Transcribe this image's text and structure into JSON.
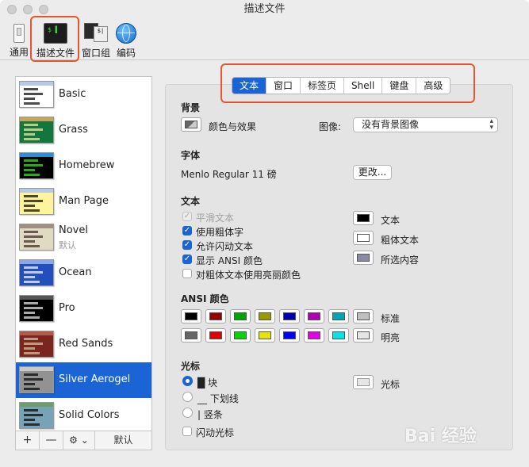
{
  "window": {
    "title": "描述文件"
  },
  "toolbar": {
    "items": [
      {
        "label": "通用",
        "icon": "switch-icon"
      },
      {
        "label": "描述文件",
        "icon": "terminal-icon"
      },
      {
        "label": "窗口组",
        "icon": "window-group-icon"
      },
      {
        "label": "编码",
        "icon": "globe-icon"
      }
    ]
  },
  "profiles": [
    {
      "name": "Basic",
      "color": "#ffffff",
      "fg": "#000000",
      "bar": "#b8c9e8"
    },
    {
      "name": "Grass",
      "color": "#13773d",
      "fg": "#fff0a5",
      "bar": "#c7a55a"
    },
    {
      "name": "Homebrew",
      "color": "#000000",
      "fg": "#28fe14",
      "bar": "#2a8fd6"
    },
    {
      "name": "Man Page",
      "color": "#fef49c",
      "fg": "#000000",
      "bar": "#b8c9e8"
    },
    {
      "name": "Novel",
      "sub": "默认",
      "color": "#dfdbc3",
      "fg": "#3b2322",
      "bar": "#9e8f7e"
    },
    {
      "name": "Ocean",
      "color": "#224fbc",
      "fg": "#ffffff",
      "bar": "#8aa8e8"
    },
    {
      "name": "Pro",
      "color": "#000000",
      "fg": "#f2f2f2",
      "bar": "#555555"
    },
    {
      "name": "Red Sands",
      "color": "#7a251e",
      "fg": "#d7c9a7",
      "bar": "#b35b4a"
    },
    {
      "name": "Silver Aerogel",
      "color": "#929292",
      "fg": "#000000",
      "bar": "#c9c9c9",
      "selected": true
    },
    {
      "name": "Solid Colors",
      "color": "#78a2b5",
      "fg": "#000000",
      "bar": "#6a9e6a"
    }
  ],
  "sidebar_bottom": {
    "add": "+",
    "remove": "—",
    "gear": "⚙ ⌄",
    "default": "默认"
  },
  "tabs": [
    {
      "label": "文本",
      "active": true
    },
    {
      "label": "窗口"
    },
    {
      "label": "标签页"
    },
    {
      "label": "Shell"
    },
    {
      "label": "键盘"
    },
    {
      "label": "高级"
    }
  ],
  "background": {
    "section": "背景",
    "color_effects": "颜色与效果",
    "image_label": "图像:",
    "image_value": "没有背景图像"
  },
  "font": {
    "section": "字体",
    "value": "Menlo Regular 11 磅",
    "change_button": "更改..."
  },
  "text": {
    "section": "文本",
    "options": [
      {
        "label": "平滑文本",
        "checked": true,
        "disabled": true
      },
      {
        "label": "使用粗体字",
        "checked": true
      },
      {
        "label": "允许闪动文本",
        "checked": true
      },
      {
        "label": "显示 ANSI 颜色",
        "checked": true
      },
      {
        "label": "对粗体文本使用亮丽颜色",
        "checked": false
      }
    ],
    "swatches": [
      {
        "label": "文本",
        "color": "#000000"
      },
      {
        "label": "粗体文本",
        "color": "#ffffff"
      },
      {
        "label": "所选内容",
        "color": "#8a8aa3"
      }
    ]
  },
  "ansi": {
    "section": "ANSI 颜色",
    "normal_label": "标准",
    "bright_label": "明亮",
    "normal": [
      "#000000",
      "#990000",
      "#00a600",
      "#999900",
      "#0000b2",
      "#b200b2",
      "#00a6b2",
      "#bfbfbf"
    ],
    "bright": [
      "#666666",
      "#e50000",
      "#00d900",
      "#e5e500",
      "#0000ff",
      "#e500e5",
      "#00e5e5",
      "#e5e5e5"
    ]
  },
  "cursor": {
    "section": "光标",
    "options": [
      {
        "label": "█ 块",
        "selected": true
      },
      {
        "label": "__ 下划线",
        "selected": false
      },
      {
        "label": "| 竖条",
        "selected": false
      }
    ],
    "blink_label": "闪动光标",
    "swatch_label": "光标",
    "swatch_color": "#e6e6e6"
  },
  "watermark": "Bai 经验"
}
